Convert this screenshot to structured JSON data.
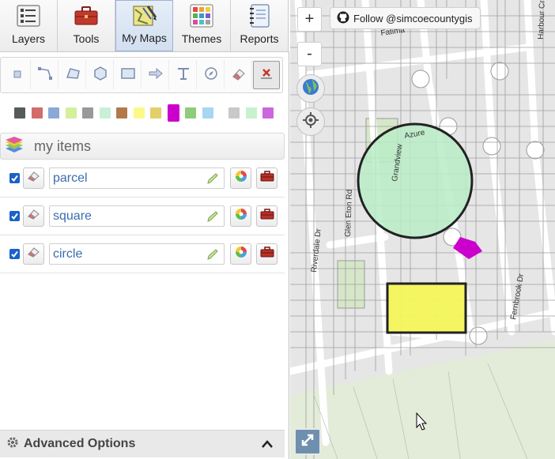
{
  "tabs": [
    {
      "label": "Layers",
      "icon": "layers-list-icon"
    },
    {
      "label": "Tools",
      "icon": "toolbox-icon"
    },
    {
      "label": "My Maps",
      "icon": "my-maps-icon",
      "active": true
    },
    {
      "label": "Themes",
      "icon": "themes-grid-icon"
    },
    {
      "label": "Reports",
      "icon": "reports-notebook-icon"
    }
  ],
  "draw_tools": [
    "point-tool-icon",
    "line-tool-icon",
    "polygon-tool-icon",
    "circle-tool-icon",
    "rectangle-tool-icon",
    "arrow-tool-icon",
    "text-tool-icon",
    "measure-tool-icon",
    "eraser-tool-icon",
    "delete-all-tool-icon"
  ],
  "palette": [
    "#555b5a",
    "#d36b6b",
    "#8aa9d6",
    "#d4f09a",
    "#999999",
    "#c8f0d8",
    "#b27a4a",
    "#fbf98a",
    "#e2cf6a",
    "#cc00cc",
    "#8ecc7a",
    "#a6d6f2",
    "#c9c9c9",
    "#c9f0cf",
    "#cc66dd"
  ],
  "selected_color": "#cc00cc",
  "my_items_label": "my items",
  "items": [
    {
      "name": "parcel"
    },
    {
      "name": "square"
    },
    {
      "name": "circle"
    }
  ],
  "advanced_label": "Advanced Options",
  "map": {
    "zoom_in": "+",
    "zoom_out": "-",
    "follow_label": "Follow @simcoecountygis",
    "streets": [
      "Glen Eton Rd",
      "Riverdale Dr",
      "Fernbrook Dr",
      "Harbour Cres",
      "Fatima",
      "Azure",
      "Grandview"
    ],
    "colors": {
      "circle": "#b8ecc7",
      "square": "#f4f65a",
      "parcel": "#cc00cc"
    }
  }
}
